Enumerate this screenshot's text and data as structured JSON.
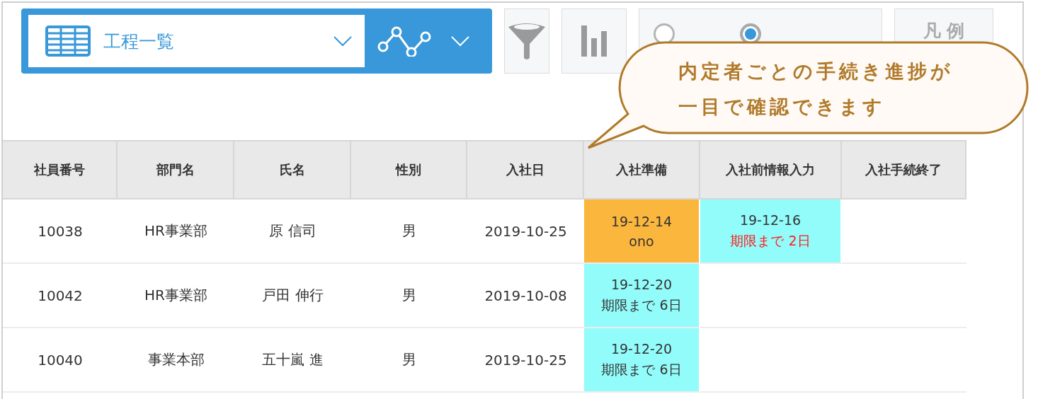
{
  "toolbar": {
    "view_select": {
      "value": "工程一覧"
    },
    "radios": [
      {
        "selected": false
      },
      {
        "selected": true
      }
    ],
    "legend_button": {
      "label": "凡 例"
    }
  },
  "callout": {
    "lines": [
      "内定者ごとの手続き進捗が",
      "一目で確認できます"
    ]
  },
  "table": {
    "columns": [
      "社員番号",
      "部門名",
      "氏名",
      "性別",
      "入社日",
      "入社準備",
      "入社前情報入力",
      "入社手続終了"
    ],
    "rows": [
      {
        "cells": [
          "10038",
          "HR事業部",
          "原 信司",
          "男",
          "2019-10-25"
        ],
        "stages": [
          {
            "date": "19-12-14",
            "note": "ono",
            "color": "#fbb63e",
            "urgent": false
          },
          {
            "date": "19-12-16",
            "note": "期限まで 2日",
            "color": "#92fcfb",
            "urgent": true
          }
        ]
      },
      {
        "cells": [
          "10042",
          "HR事業部",
          "戸田 伸行",
          "男",
          "2019-10-08"
        ],
        "stages": [
          {
            "date": "19-12-20",
            "note": "期限まで 6日",
            "color": "#92fcfb",
            "urgent": false
          }
        ]
      },
      {
        "cells": [
          "10040",
          "事業本部",
          "五十嵐 進",
          "男",
          "2019-10-25"
        ],
        "stages": [
          {
            "date": "19-12-20",
            "note": "期限まで 6日",
            "color": "#92fcfb",
            "urgent": false
          }
        ]
      }
    ]
  }
}
